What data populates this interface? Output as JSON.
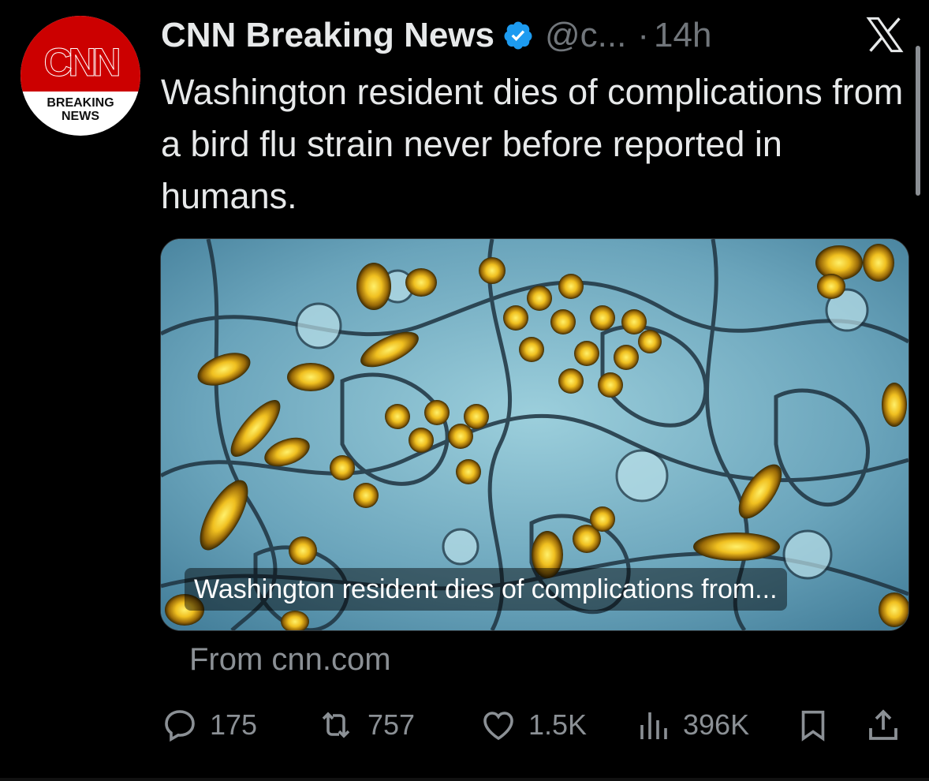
{
  "author": {
    "name": "CNN Breaking News",
    "handle": "@c...",
    "separator": "·",
    "time": "14h",
    "avatar_logo": "CNN",
    "avatar_text_line1": "BREAKING",
    "avatar_text_line2": "NEWS",
    "verified_icon": "verified-badge-icon"
  },
  "platform_icon": "x-logo-icon",
  "tweet": {
    "text": "Washington resident dies of complications from a bird flu strain never before reported in humans."
  },
  "link_card": {
    "image": "microscopy-virus-image",
    "caption": "Washington resident dies of complications from..."
  },
  "source": "From cnn.com",
  "actions": {
    "replies": "175",
    "reposts": "757",
    "likes": "1.5K",
    "views": "396K"
  },
  "colors": {
    "background": "#000000",
    "text": "#e7e9ea",
    "muted": "#8b9095",
    "verified": "#1d9bf0",
    "cnn_red": "#cc0000"
  }
}
